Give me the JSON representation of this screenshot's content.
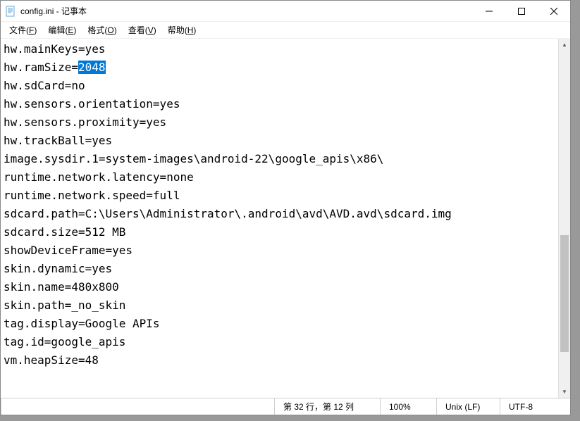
{
  "window": {
    "title": "config.ini - 记事本"
  },
  "menu": {
    "file": "文件(F)",
    "edit": "编辑(E)",
    "format": "格式(O)",
    "view": "查看(V)",
    "help": "帮助(H)"
  },
  "editor": {
    "lines": [
      {
        "prefix": "hw.mainKeys=yes",
        "sel": "",
        "suffix": ""
      },
      {
        "prefix": "hw.ramSize=",
        "sel": "2048",
        "suffix": ""
      },
      {
        "prefix": "hw.sdCard=no",
        "sel": "",
        "suffix": ""
      },
      {
        "prefix": "hw.sensors.orientation=yes",
        "sel": "",
        "suffix": ""
      },
      {
        "prefix": "hw.sensors.proximity=yes",
        "sel": "",
        "suffix": ""
      },
      {
        "prefix": "hw.trackBall=yes",
        "sel": "",
        "suffix": ""
      },
      {
        "prefix": "image.sysdir.1=system-images\\android-22\\google_apis\\x86\\",
        "sel": "",
        "suffix": ""
      },
      {
        "prefix": "runtime.network.latency=none",
        "sel": "",
        "suffix": ""
      },
      {
        "prefix": "runtime.network.speed=full",
        "sel": "",
        "suffix": ""
      },
      {
        "prefix": "sdcard.path=C:\\Users\\Administrator\\.android\\avd\\AVD.avd\\sdcard.img",
        "sel": "",
        "suffix": ""
      },
      {
        "prefix": "sdcard.size=512 MB",
        "sel": "",
        "suffix": ""
      },
      {
        "prefix": "showDeviceFrame=yes",
        "sel": "",
        "suffix": ""
      },
      {
        "prefix": "skin.dynamic=yes",
        "sel": "",
        "suffix": ""
      },
      {
        "prefix": "skin.name=480x800",
        "sel": "",
        "suffix": ""
      },
      {
        "prefix": "skin.path=_no_skin",
        "sel": "",
        "suffix": ""
      },
      {
        "prefix": "tag.display=Google APIs",
        "sel": "",
        "suffix": ""
      },
      {
        "prefix": "tag.id=google_apis",
        "sel": "",
        "suffix": ""
      },
      {
        "prefix": "vm.heapSize=48",
        "sel": "",
        "suffix": ""
      }
    ]
  },
  "status": {
    "position": "第 32 行，第 12 列",
    "zoom": "100%",
    "eol": "Unix (LF)",
    "encoding": "UTF-8"
  }
}
